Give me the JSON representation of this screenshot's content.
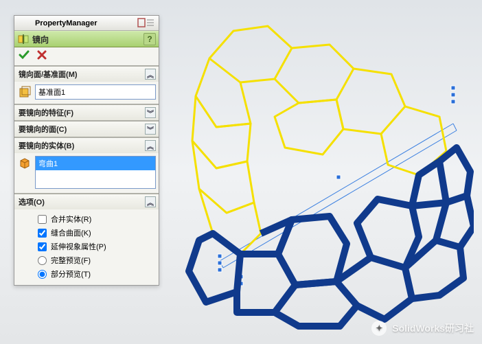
{
  "header": {
    "title": "PropertyManager"
  },
  "feature": {
    "title": "镜向",
    "help": "?"
  },
  "sections": {
    "mirror_face": {
      "label": "镜向面/基准面(M)",
      "items": [
        "基准面1"
      ]
    },
    "features": {
      "label": "要镜向的特征(F)"
    },
    "faces": {
      "label": "要镜向的面(C)"
    },
    "bodies": {
      "label": "要镜向的实体(B)",
      "items": [
        "弯曲1"
      ]
    },
    "options": {
      "label": "选项(O)",
      "merge": {
        "label": "合并实体(R)",
        "checked": false
      },
      "knit": {
        "label": "缝合曲面(K)",
        "checked": true
      },
      "propvis": {
        "label": "延伸视象属性(P)",
        "checked": true
      },
      "fullprev": {
        "label": "完整预览(F)",
        "selected": false
      },
      "partprev": {
        "label": "部分预览(T)",
        "selected": true
      }
    }
  },
  "watermark": {
    "text": "SolidWorks研习社"
  }
}
